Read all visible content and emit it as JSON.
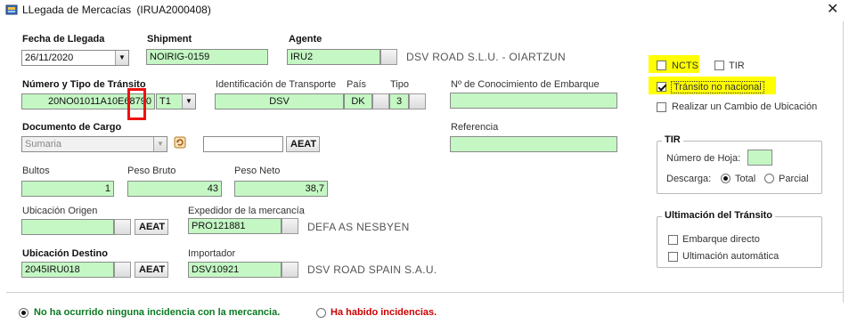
{
  "window": {
    "title": "LLegada de Mercacías",
    "doc_id": "(IRUA2000408)",
    "close_glyph": "✕"
  },
  "arrival": {
    "fecha_label": "Fecha de Llegada",
    "fecha_value": "26/11/2020",
    "shipment_label": "Shipment",
    "shipment_value": "NOIRIG-0159",
    "agente_label": "Agente",
    "agente_value": "IRU2",
    "agente_name": "DSV ROAD S.L.U. - OIARTZUN"
  },
  "transit": {
    "numero_label": "Número y Tipo de Tránsito",
    "numero_value": "20NO01011A10E68790",
    "tipo_value": "T1",
    "ident_label": "Identificación de Transporte",
    "ident_value": "DSV",
    "pais_label": "País",
    "pais_value": "DK",
    "tipo_label": "Tipo",
    "tipo_num": "3",
    "conocimiento_label": "Nº de Conocimiento de Embarque",
    "conocimiento_value": ""
  },
  "cargo": {
    "doc_label": "Documento de Cargo",
    "doc_value": "Sumaria",
    "doc_number": "",
    "aeat_label": "AEAT",
    "referencia_label": "Referencia",
    "referencia_value": ""
  },
  "weights": {
    "bultos_label": "Bultos",
    "bultos_value": "1",
    "bruto_label": "Peso Bruto",
    "bruto_value": "43",
    "neto_label": "Peso Neto",
    "neto_value": "38,7"
  },
  "origin": {
    "ubic_label": "Ubicación Origen",
    "ubic_value": "",
    "aeat_label": "AEAT",
    "expedidor_label": "Expedidor de la mercancía",
    "expedidor_value": "PRO121881",
    "expedidor_name": "DEFA AS NESBYEN"
  },
  "destination": {
    "ubic_label": "Ubicación Destino",
    "ubic_value": "2045IRU018",
    "aeat_label": "AEAT",
    "importador_label": "Importador",
    "importador_value": "DSV10921",
    "importador_name": "DSV ROAD SPAIN S.A.U."
  },
  "options": {
    "ncts_label": "NCTS",
    "ncts_checked": false,
    "tir_label": "TIR",
    "tir_checked": false,
    "transito_label": "Tránsito no nacional",
    "transito_checked": true,
    "cambio_label": "Realizar un Cambio de Ubicación",
    "cambio_checked": false
  },
  "tir_group": {
    "title": "TIR",
    "hoja_label": "Número de Hoja:",
    "hoja_value": "",
    "descarga_label": "Descarga:",
    "total_label": "Total",
    "parcial_label": "Parcial",
    "selected": "Total"
  },
  "ultimacion": {
    "title": "Ultimación del Tránsito",
    "embarque_label": "Embarque directo",
    "automatica_label": "Ultimación automática"
  },
  "incidents": {
    "ok_label": "No ha ocurrido ninguna incidencia con la mercancia.",
    "bad_label": "Ha habido incidencias.",
    "selected": "ok"
  },
  "colors": {
    "field_green": "#c4f7c4",
    "highlight_yellow": "#ffff00",
    "annotation_red": "#ee1111",
    "ok_green": "#0b7a22",
    "bad_red": "#cc0000"
  }
}
